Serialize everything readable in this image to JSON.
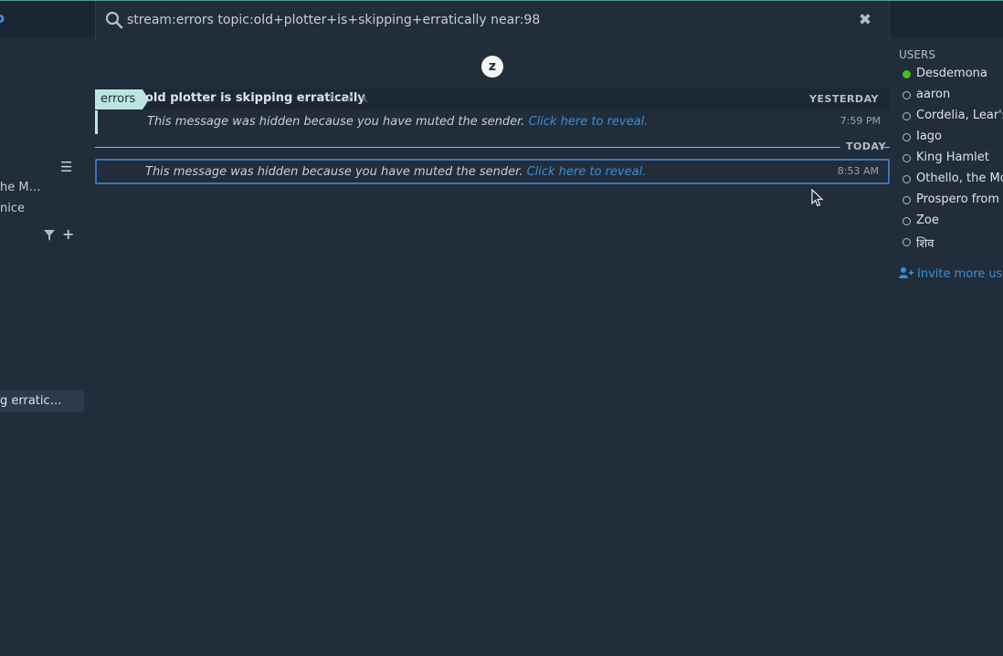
{
  "search": {
    "value": "stream:errors topic:old+plotter+is+skipping+erratically near:98",
    "clear_glyph": "✖"
  },
  "left_sidebar": {
    "items_partial": [
      "he M…",
      "nice"
    ],
    "active_topic_partial": "g erratic…"
  },
  "recipient": {
    "stream": "errors",
    "topic": "old plotter is skipping erratically",
    "date": "YESTERDAY"
  },
  "messages": [
    {
      "text": "This message was hidden because you have muted the sender.",
      "link": "Click here to reveal.",
      "time": "7:59 PM"
    },
    {
      "text": "This message was hidden because you have muted the sender.",
      "link": "Click here to reveal.",
      "time": "8:53 AM"
    }
  ],
  "date_divider": "TODAY",
  "logo_letter": "z",
  "users": {
    "title": "USERS",
    "list": [
      {
        "name": "Desdemona",
        "active": true
      },
      {
        "name": "aaron",
        "active": false
      },
      {
        "name": "Cordelia, Lear's d",
        "active": false
      },
      {
        "name": "Iago",
        "active": false
      },
      {
        "name": "King Hamlet",
        "active": false
      },
      {
        "name": "Othello, the Moo",
        "active": false
      },
      {
        "name": "Prospero from Th",
        "active": false
      },
      {
        "name": "Zoe",
        "active": false
      },
      {
        "name": "शिव",
        "active": false
      }
    ],
    "invite": "Invite more user"
  },
  "colors": {
    "background": "#212d3b",
    "stream": "#bde5e0",
    "link": "#3b8fd6",
    "selected_border": "#3e74b6",
    "active_presence": "#44c21d"
  }
}
